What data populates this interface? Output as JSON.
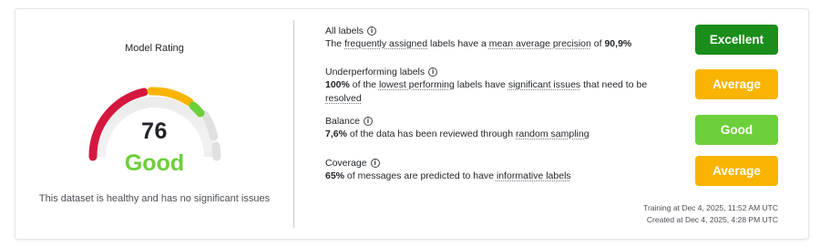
{
  "model_rating": {
    "title": "Model Rating",
    "score": "76",
    "verdict": "Good",
    "verdict_color": "#6dcf3a",
    "summary": "This dataset is healthy and has no significant issues",
    "gauge_colors": {
      "red": "#d5173f",
      "orange": "#f8b400",
      "green": "#6dcf3a",
      "track": "#e0e0e0"
    }
  },
  "metrics": [
    {
      "title": "All labels",
      "desc_parts": [
        "The ",
        "frequently assigned",
        " labels have a ",
        "mean average precision",
        " of ",
        "90,9%"
      ],
      "rating": "Excellent",
      "rating_color": "#1a8d1b"
    },
    {
      "title": "Underperforming labels",
      "desc_parts": [
        "100%",
        " of the ",
        "lowest performing",
        " labels have ",
        "significant issues",
        " that need to be ",
        "resolved"
      ],
      "rating": "Average",
      "rating_color": "#f8b400"
    },
    {
      "title": "Balance",
      "desc_parts": [
        "7,6%",
        " of the data has been reviewed through ",
        "random sampling"
      ],
      "rating": "Good",
      "rating_color": "#6dcf3a"
    },
    {
      "title": "Coverage",
      "desc_parts": [
        "65%",
        " of messages are predicted to have ",
        "informative labels"
      ],
      "rating": "Average",
      "rating_color": "#f8b400"
    }
  ],
  "footer": {
    "training": "Training at Dec 4, 2025, 11:52 AM UTC",
    "created": "Created at Dec 4, 2025, 4:28 PM UTC"
  }
}
